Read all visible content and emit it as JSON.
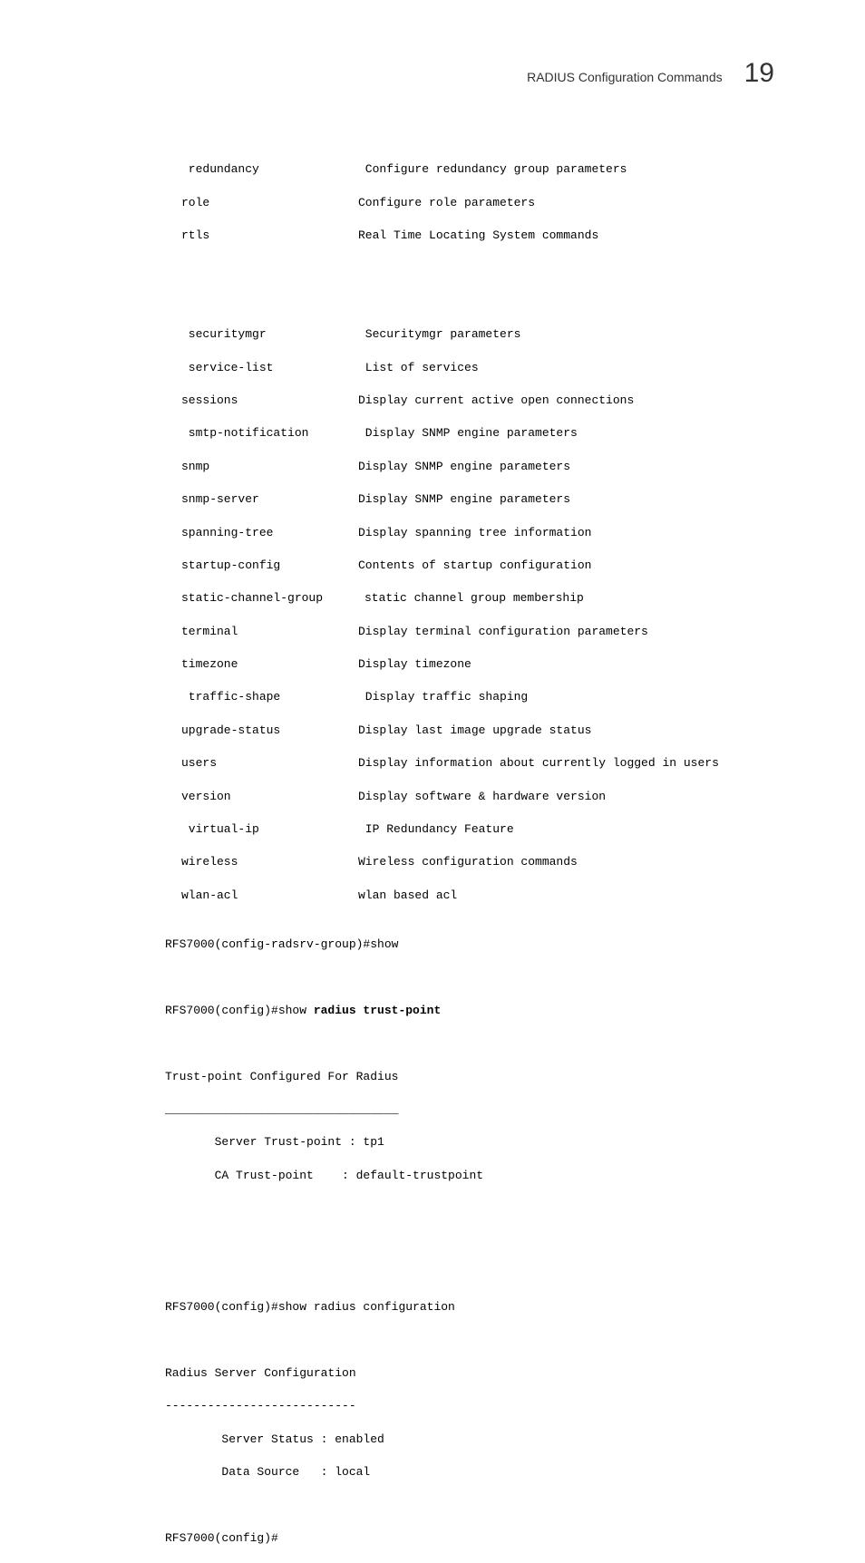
{
  "header": {
    "title": "RADIUS Configuration Commands",
    "chapter": "19"
  },
  "commands": [
    {
      "name": " redundancy",
      "desc": " Configure redundancy group parameters"
    },
    {
      "name": "role",
      "desc": "Configure role parameters"
    },
    {
      "name": "rtls",
      "desc": "Real Time Locating System commands"
    }
  ],
  "commands2": [
    {
      "name": " securitymgr",
      "desc": " Securitymgr parameters"
    },
    {
      "name": " service-list",
      "desc": " List of services"
    },
    {
      "name": "sessions",
      "desc": "Display current active open connections"
    },
    {
      "name": " smtp-notification",
      "desc": " Display SNMP engine parameters"
    },
    {
      "name": "snmp",
      "desc": "Display SNMP engine parameters"
    },
    {
      "name": "snmp-server",
      "desc": "Display SNMP engine parameters"
    },
    {
      "name": "spanning-tree",
      "desc": "Display spanning tree information"
    },
    {
      "name": "startup-config",
      "desc": "Contents of startup configuration"
    },
    {
      "name": "static-channel-group",
      "desc": "static channel group membership"
    },
    {
      "name": "terminal",
      "desc": "Display terminal configuration parameters"
    },
    {
      "name": "timezone",
      "desc": "Display timezone"
    },
    {
      "name": " traffic-shape",
      "desc": " Display traffic shaping"
    },
    {
      "name": "upgrade-status",
      "desc": "Display last image upgrade status"
    },
    {
      "name": "users",
      "desc": "Display information about currently logged in users"
    },
    {
      "name": "version",
      "desc": "Display software & hardware version"
    },
    {
      "name": " virtual-ip",
      "desc": " IP Redundancy Feature"
    },
    {
      "name": "wireless",
      "desc": "Wireless configuration commands"
    },
    {
      "name": "wlan-acl",
      "desc": "wlan based acl"
    }
  ],
  "line_show_prompt": "RFS7000(config-radsrv-group)#show",
  "trustpoint_cmd_prefix": "RFS7000(config)#show ",
  "trustpoint_cmd_bold": "radius trust-point",
  "trustpoint_header": "Trust-point Configured For Radius",
  "trustpoint_sep": "_________________________________",
  "trustpoint_lines": [
    "       Server Trust-point : tp1",
    "       CA Trust-point    : default-trustpoint"
  ],
  "radius_cfg_cmd": "RFS7000(config)#show radius configuration",
  "radius_cfg_header": "Radius Server Configuration",
  "radius_cfg_sep": "---------------------------",
  "radius_cfg_lines": [
    "        Server Status : enabled",
    "        Data Source   : local"
  ],
  "final_prompt": "RFS7000(config)#"
}
